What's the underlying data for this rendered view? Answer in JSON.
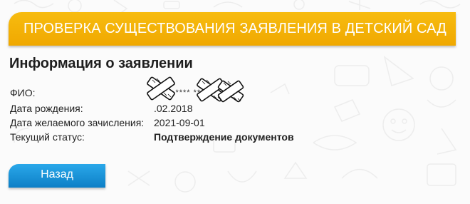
{
  "banner": {
    "title": "ПРОВЕРКА СУЩЕСТВОВАНИЯ ЗАЯВЛЕНИЯ В ДЕТСКИЙ САД"
  },
  "info": {
    "heading": "Информация о заявлении",
    "rows": [
      {
        "label": "ФИО:",
        "value": "*****  ****  ******"
      },
      {
        "label": "Дата рождения:",
        "value": ".02.2018"
      },
      {
        "label": "Дата желаемого зачисления:",
        "value": "2021-09-01"
      },
      {
        "label": "Текущий статус:",
        "value": "Подтверждение документов"
      }
    ]
  },
  "actions": {
    "back_label": "Назад"
  },
  "colors": {
    "banner": "#f4b20a",
    "button": "#1a93d8",
    "text": "#222222"
  }
}
